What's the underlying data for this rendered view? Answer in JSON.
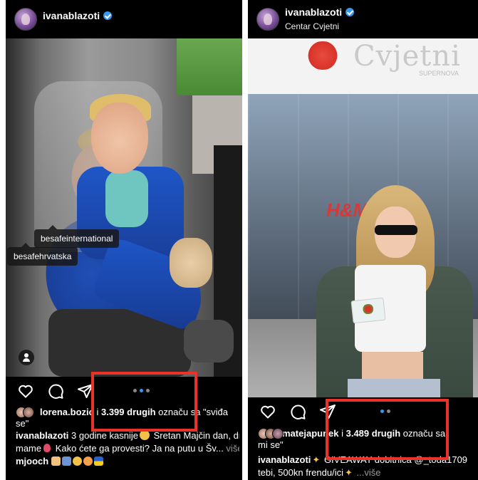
{
  "left_post": {
    "username": "ivanablazoti",
    "tags": [
      "besafeinternational",
      "besafehrvatska"
    ],
    "likes": {
      "name": "lorena.bozic",
      "middle": " i ",
      "count": "3.399 drugih",
      "suffix": " označu sa \"sviđa",
      "continuation": "se\""
    },
    "caption": {
      "line1_user": "ivanablazoti",
      "line1_text": " 3 godine kasnije",
      "line1_text2": " Sretan Majčin dan, dr",
      "line2_text": "mame",
      "line2_text2": " Kako ćete ga provesti? Ja na putu u Šv...",
      "line2_more": " više",
      "line3_user": "mjooch"
    },
    "carousel_active_index": 1
  },
  "right_post": {
    "username": "ivanablazoti",
    "location": "Centar Cvjetni",
    "sign_text": "Cvjetni",
    "sign_sub": "SUPERNOVA",
    "store_logo": "H&M",
    "likes": {
      "name": "matejapunek",
      "middle": " i ",
      "count": "3.489 drugih",
      "suffix": " označu sa",
      "continuation": "mi se\""
    },
    "caption": {
      "line1_user": "ivanablazoti",
      "line1_text": " GIVEAWAY dobitnica @_toda1709",
      "line2_text": "tebi, 500kn frendu/ici",
      "line2_more": " ...više"
    },
    "carousel_active_index": 1
  },
  "icons": {
    "verified": "verified-badge-icon",
    "like": "heart-icon",
    "comment": "comment-icon",
    "share": "send-icon",
    "tagged_people": "person-icon"
  },
  "colors": {
    "background": "#000000",
    "text": "#ffffff",
    "verified": "#3897f0",
    "active_dot": "#3897f0",
    "highlight_box": "#e8322a"
  }
}
